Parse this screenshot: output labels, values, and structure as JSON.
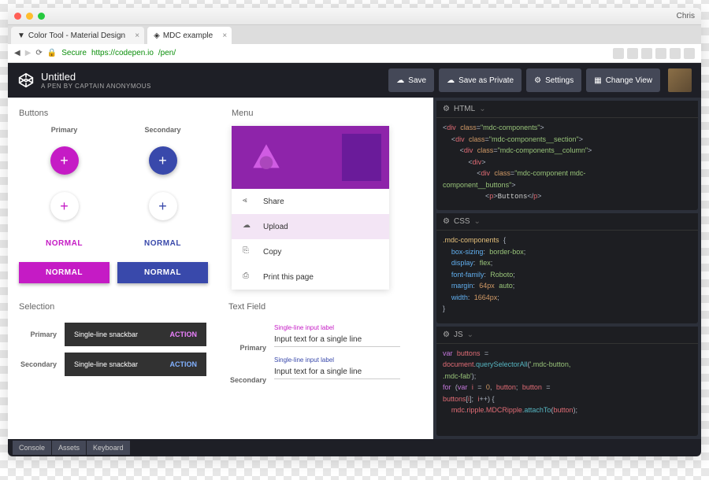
{
  "os": {
    "user": "Chris"
  },
  "tabs": [
    {
      "label": "Color Tool - Material Design",
      "active": false
    },
    {
      "label": "MDC example",
      "active": true
    }
  ],
  "address": {
    "secure_label": "Secure",
    "host": "https://codepen.io",
    "path": "/pen/"
  },
  "header": {
    "title": "Untitled",
    "subtitle": "A PEN BY CAPTAIN ANONYMOUS",
    "actions": {
      "save": "Save",
      "save_private": "Save as Private",
      "settings": "Settings",
      "change_view": "Change View"
    }
  },
  "preview": {
    "buttons": {
      "heading": "Buttons",
      "primary_h": "Primary",
      "secondary_h": "Secondary",
      "normal": "NORMAL"
    },
    "menu": {
      "heading": "Menu",
      "items": [
        {
          "label": "Share"
        },
        {
          "label": "Upload"
        },
        {
          "label": "Copy"
        },
        {
          "label": "Print this page"
        }
      ]
    },
    "selection": {
      "heading": "Selection",
      "primary_h": "Primary",
      "secondary_h": "Secondary",
      "snack_text": "Single-line snackbar",
      "action": "ACTION"
    },
    "textfield": {
      "heading": "Text Field",
      "primary_h": "Primary",
      "secondary_h": "Secondary",
      "label": "Single-line input label",
      "value": "Input text for a single line"
    }
  },
  "editors": {
    "html": {
      "title": "HTML"
    },
    "css": {
      "title": "CSS"
    },
    "js": {
      "title": "JS"
    }
  },
  "footer": {
    "console": "Console",
    "assets": "Assets",
    "keyboard": "Keyboard"
  }
}
